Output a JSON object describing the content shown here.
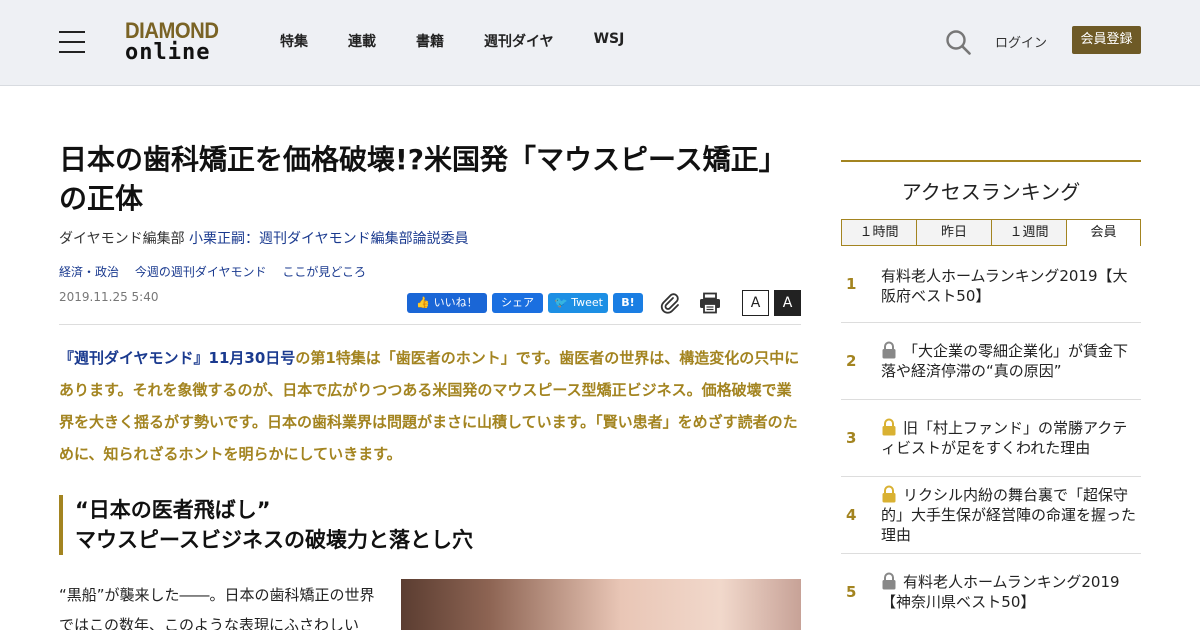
{
  "header": {
    "logo_line1": "DIAMOND",
    "logo_line2": "online",
    "nav": [
      "特集",
      "連載",
      "書籍",
      "週刊ダイヤ",
      "WSJ"
    ],
    "login_label": "ログイン",
    "register_label": "会員登録"
  },
  "article": {
    "title": "日本の歯科矯正を価格破壊!?米国発「マウスピース矯正」の正体",
    "byline_prefix": "ダイヤモンド編集部 ",
    "byline_author": "小栗正嗣：週刊ダイヤモンド編集部論説委員",
    "tags": [
      "経済・政治",
      "今週の週刊ダイヤモンド",
      "ここが見どころ"
    ],
    "date": "2019.11.25 5:40",
    "share": {
      "like": "いいね！",
      "fb_share": "シェア",
      "tweet": "Tweet",
      "hatena": "B!"
    },
    "font_small": "A",
    "font_large": "A",
    "lead_link": "『週刊ダイヤモンド』11月30日号",
    "lead_text": "の第1特集は「歯医者のホント」です。歯医者の世界は、構造変化の只中にあります。それを象徴するのが、日本で広がりつつある米国発のマウスピース型矯正ビジネス。価格破壊で業界を大きく揺るがす勢いです。日本の歯科業界は問題がまさに山積しています。「賢い患者」をめざす読者のために、知られざるホントを明らかにしていきます。",
    "subhead_line1": "“日本の医者飛ばし”",
    "subhead_line2": "マウスピースビジネスの破壊力と落とし穴",
    "body_line1": "“黒船”が襲来した――。日本の歯科矯正の世界",
    "body_line2": "ではこの数年、このような表現にふさわしい"
  },
  "sidebar": {
    "title": "アクセスランキング",
    "tabs": [
      "１時間",
      "昨日",
      "１週間",
      "会員"
    ],
    "active_tab": "会員",
    "ranking": [
      {
        "rank": "1",
        "text": "有料老人ホームランキング2019【大阪府ベスト50】",
        "lock": "none"
      },
      {
        "rank": "2",
        "text": "「大企業の零細企業化」が賃金下落や経済停滞の“真の原因”",
        "lock": "gray"
      },
      {
        "rank": "3",
        "text": "旧「村上ファンド」の常勝アクティビストが足をすくわれた理由",
        "lock": "gold"
      },
      {
        "rank": "4",
        "text": "リクシル内紛の舞台裏で「超保守的」大手生保が経営陣の命運を握った理由",
        "lock": "gold"
      },
      {
        "rank": "5",
        "text": "有料老人ホームランキング2019【神奈川県ベスト50】",
        "lock": "gray"
      }
    ]
  },
  "colors": {
    "accent_gold": "#a38420",
    "link_blue": "#1a3a8f",
    "register_bg": "#6e5a26",
    "header_bg": "#eef0f4"
  }
}
